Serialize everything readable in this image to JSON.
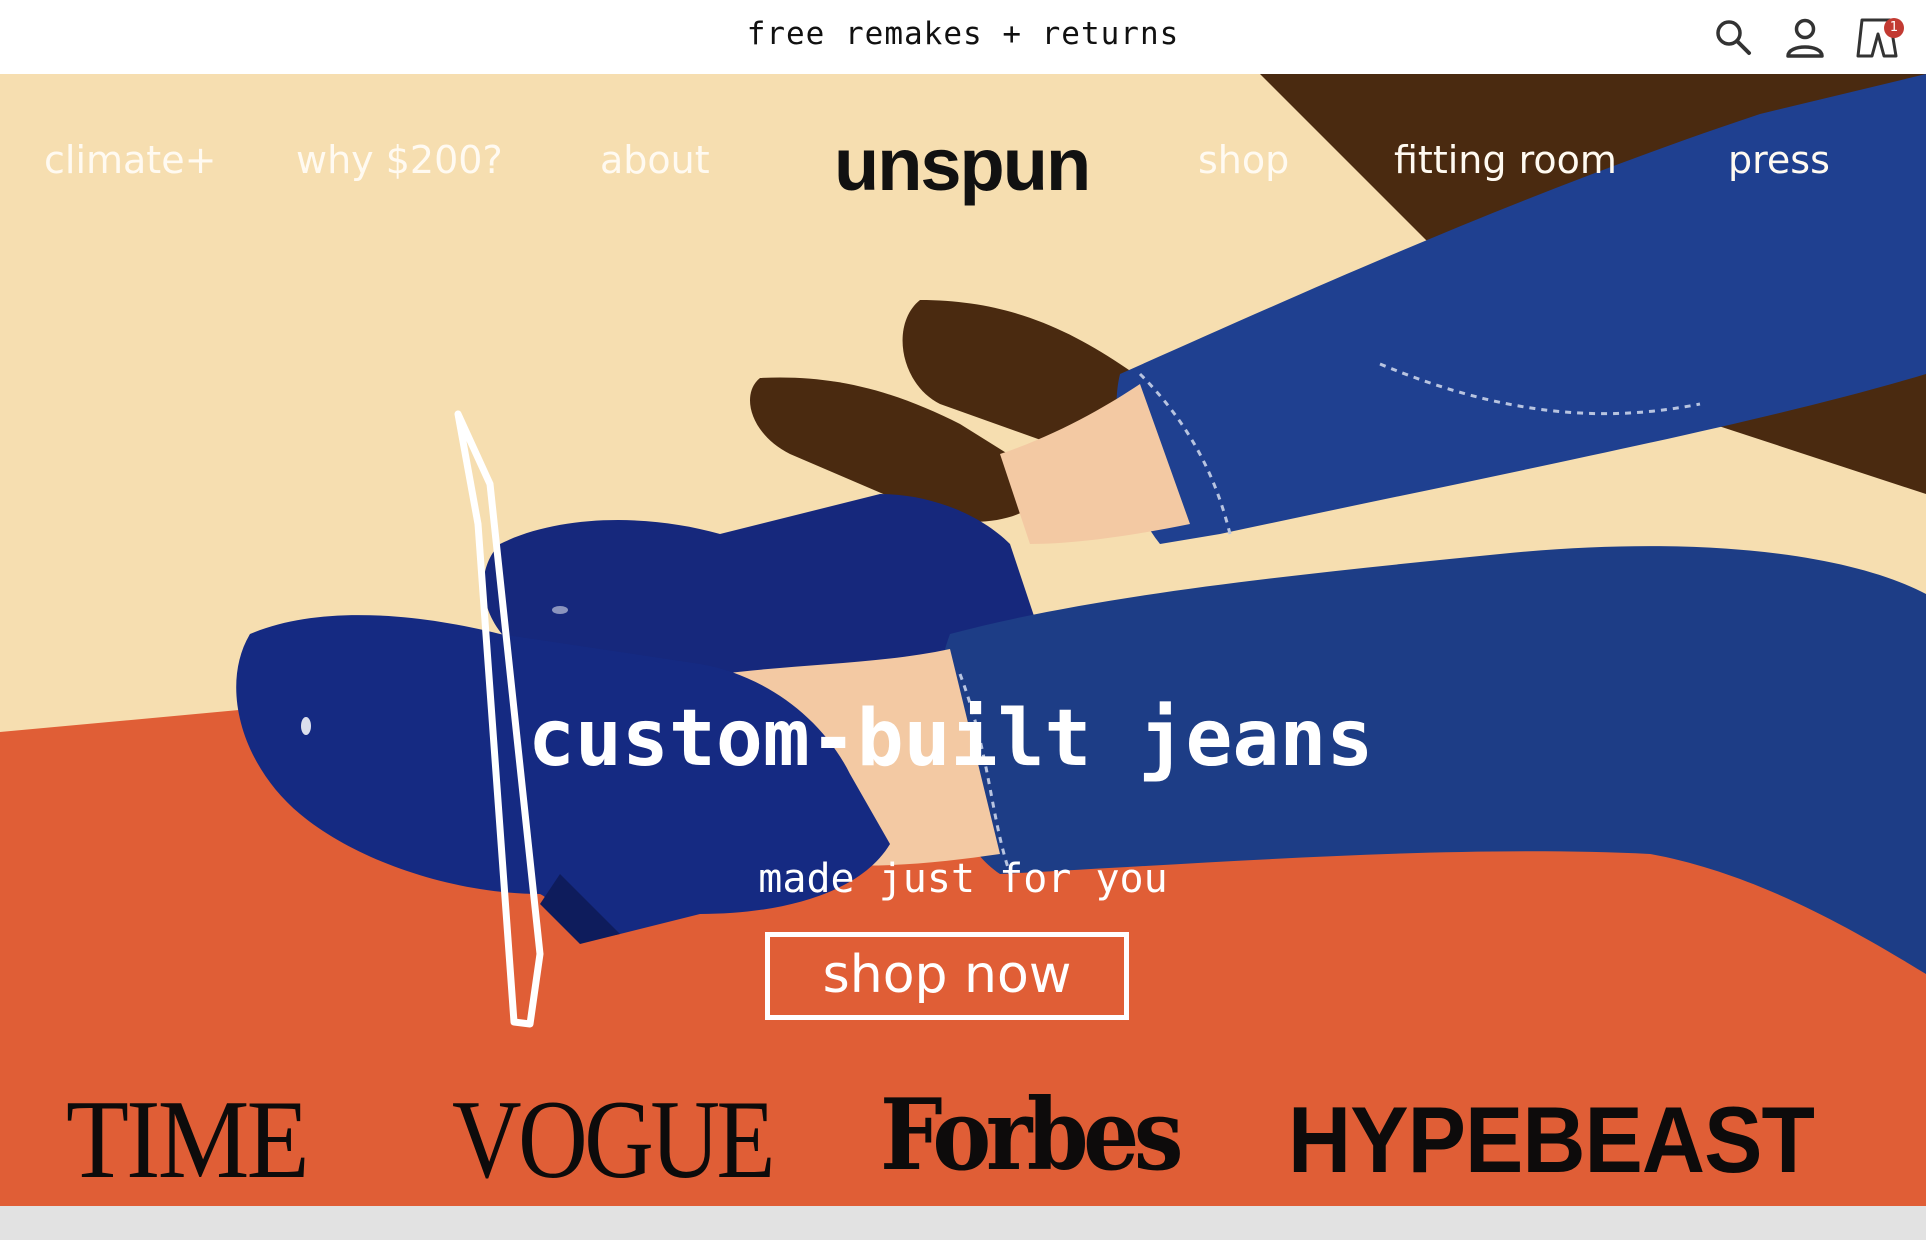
{
  "announcement": {
    "text": "free remakes + returns"
  },
  "header_icons": {
    "search": "search-icon",
    "account": "user-icon",
    "cart": "cart-icon",
    "cart_count": "1"
  },
  "nav": {
    "logo": "unspun",
    "left": [
      {
        "label": "climate+"
      },
      {
        "label": "why $200?"
      },
      {
        "label": "about"
      }
    ],
    "right": [
      {
        "label": "shop"
      },
      {
        "label": "fitting room"
      },
      {
        "label": "press"
      }
    ]
  },
  "hero": {
    "headline": "custom-built jeans",
    "subheadline": "made just for you",
    "cta_label": "shop now"
  },
  "press": {
    "logos": [
      "TIME",
      "VOGUE",
      "Forbes",
      "HYPEBEAST"
    ]
  },
  "colors": {
    "wall": "#f6deb0",
    "floor": "#e05e36",
    "denim": "#1c3c80",
    "boot": "#15257a",
    "shadow": "#4a2a10"
  }
}
